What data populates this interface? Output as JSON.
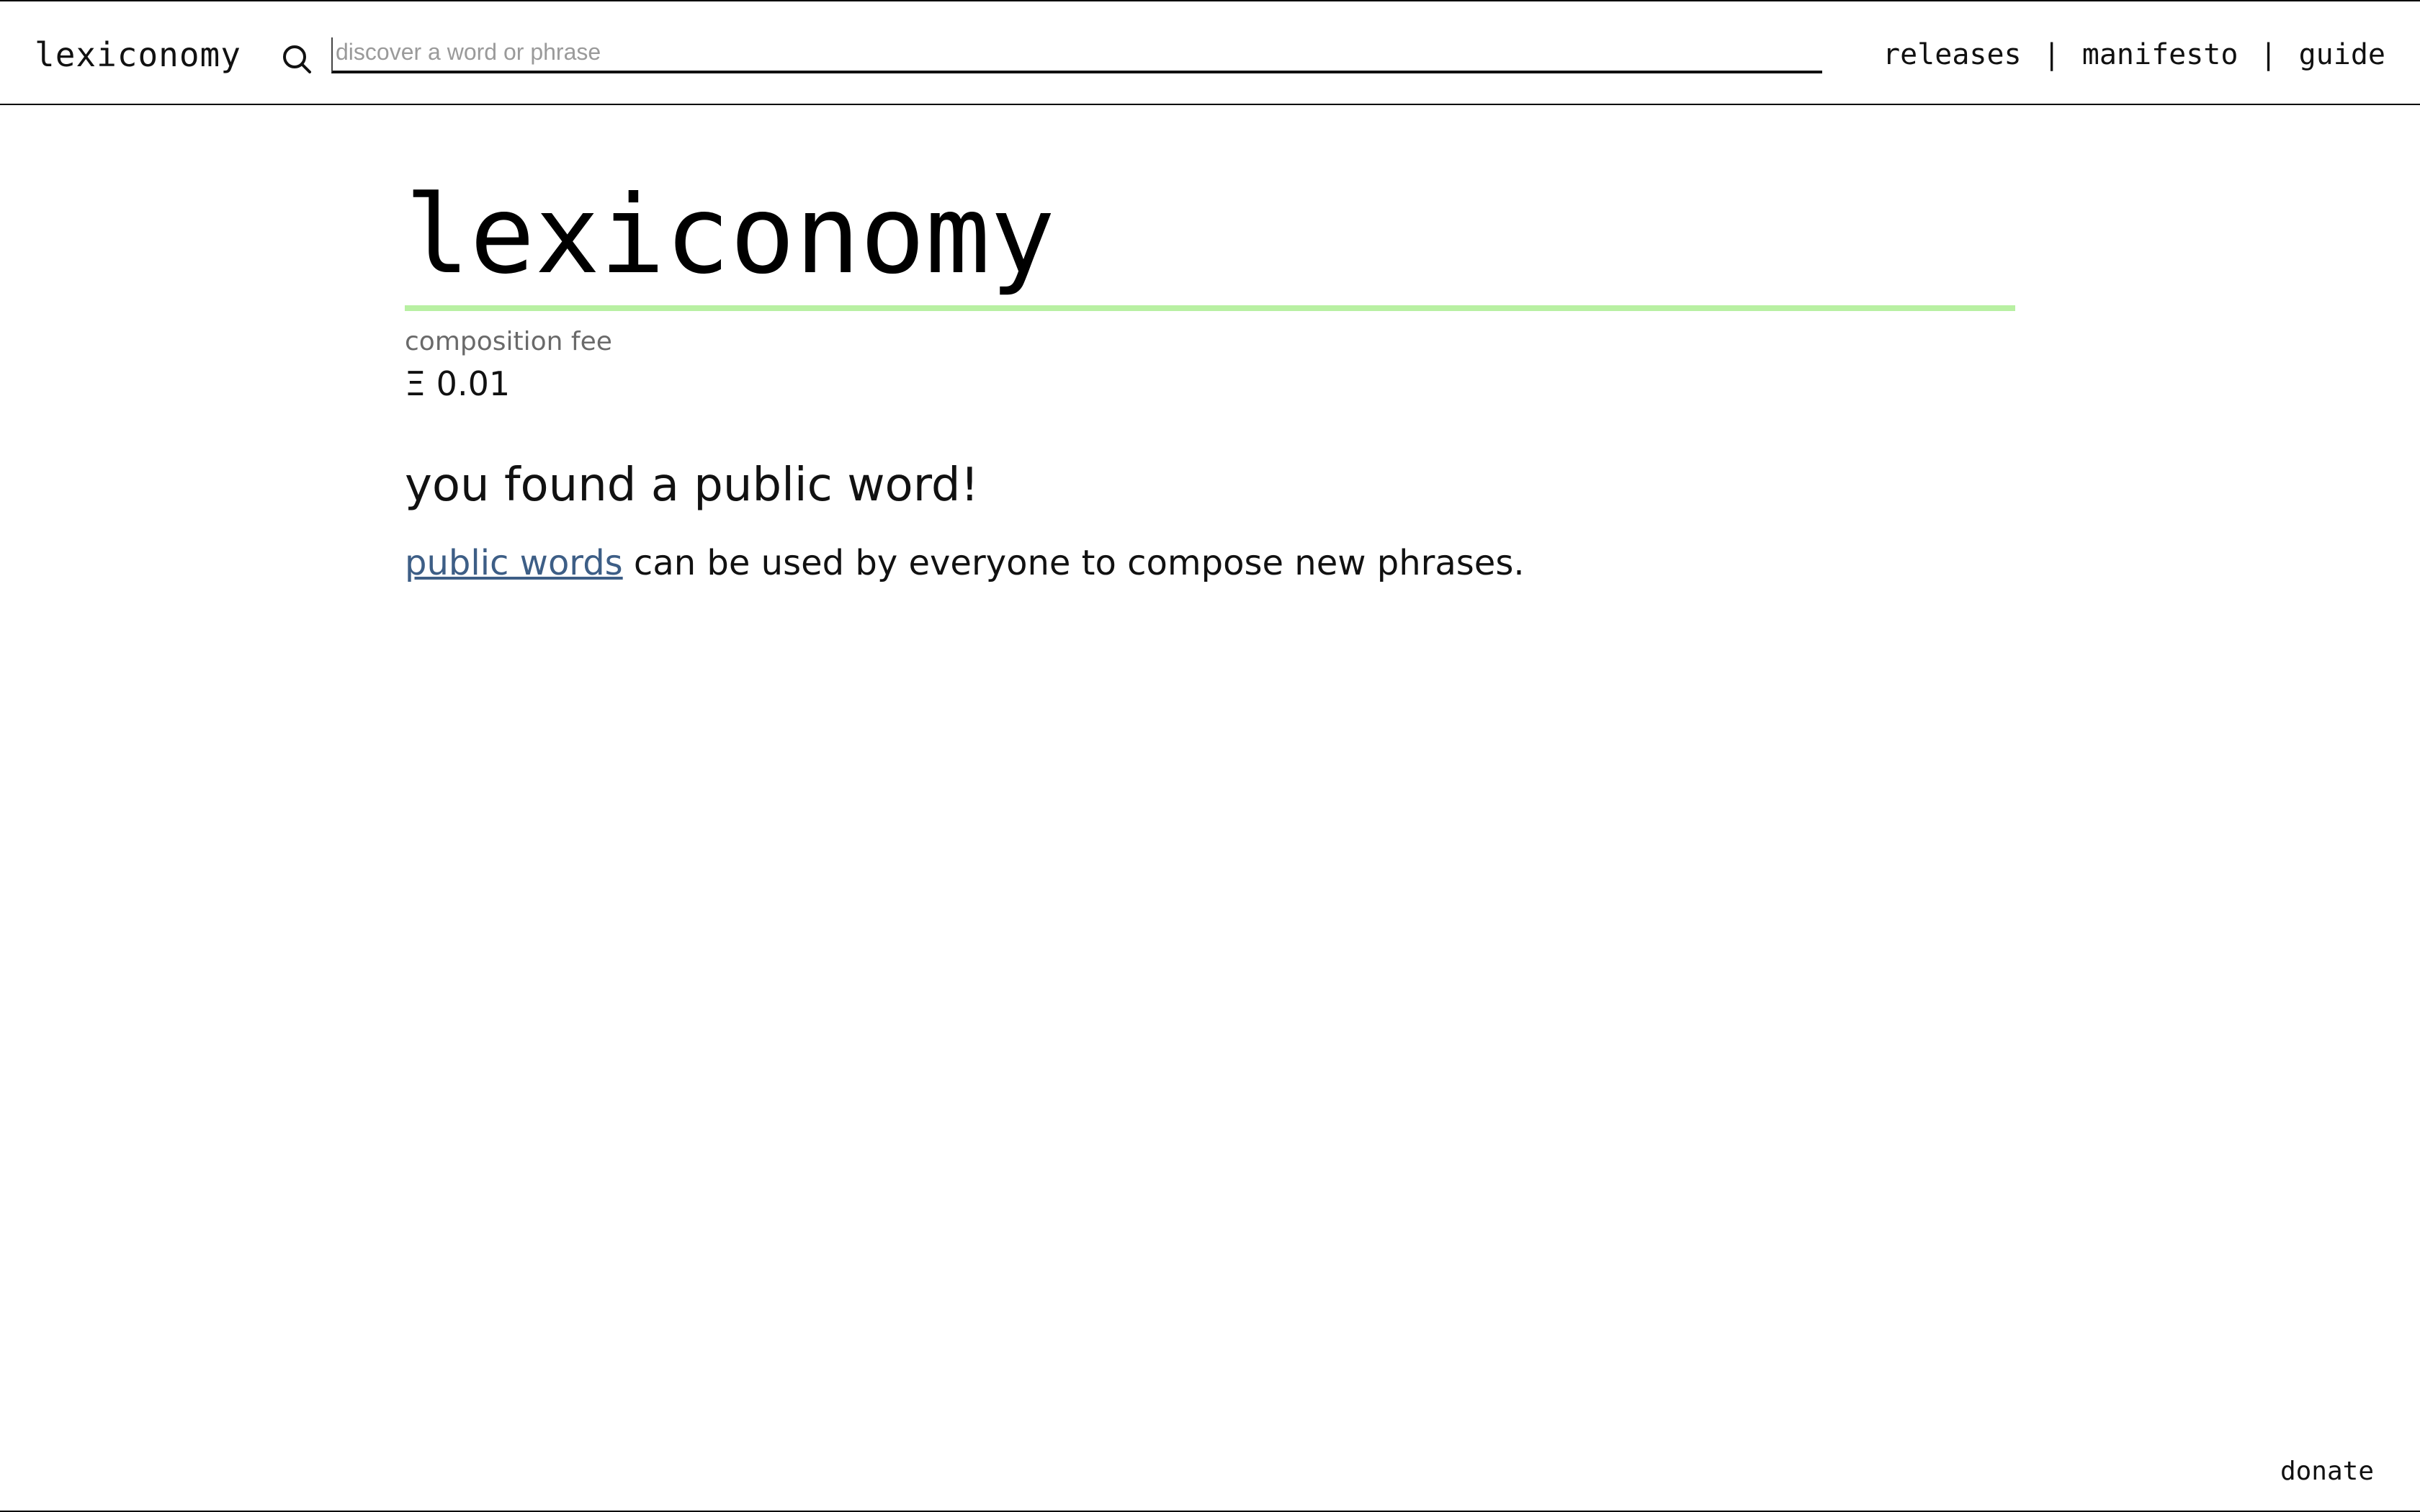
{
  "header": {
    "brand": "lexiconomy",
    "search": {
      "placeholder": "discover a word or phrase",
      "value": ""
    },
    "nav": [
      {
        "label": "releases"
      },
      {
        "label": "manifesto"
      },
      {
        "label": "guide"
      }
    ],
    "separator": "|"
  },
  "main": {
    "word": "lexiconomy",
    "fee_label": "composition fee",
    "fee_value": "Ξ 0.01",
    "heading": "you found a public word!",
    "description_link": "public words",
    "description_rest": " can be used by everyone to compose new phrases."
  },
  "footer": {
    "donate": "donate"
  },
  "colors": {
    "accent_rule": "#b8f0a2",
    "link": "#3d5e86",
    "muted": "#6a6a6a"
  },
  "icons": {
    "search": "search-icon"
  }
}
